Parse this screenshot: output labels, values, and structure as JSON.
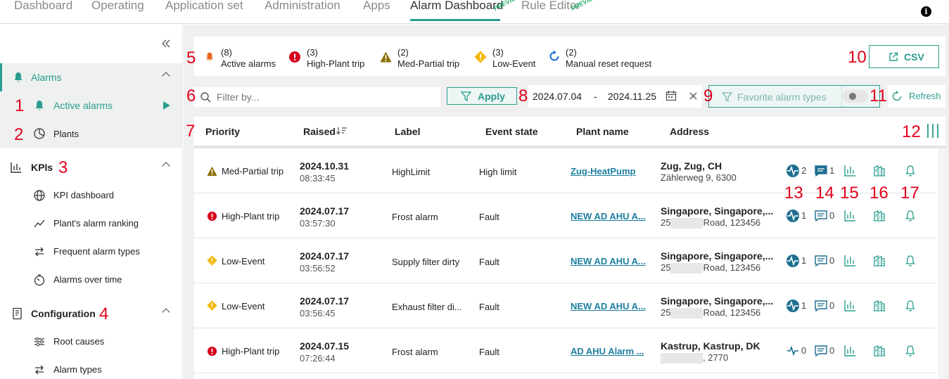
{
  "nav": {
    "tabs": [
      "Dashboard",
      "Operating",
      "Application set",
      "Administration",
      "Apps",
      "Alarm Dashboard",
      "Rule Editor"
    ],
    "active": "Alarm Dashboard",
    "preview_label": "PREVIEW"
  },
  "sidebar": {
    "alarms": {
      "label": "Alarms",
      "items": [
        {
          "label": "Active alarms"
        },
        {
          "label": "Plants"
        }
      ]
    },
    "kpis": {
      "label": "KPIs",
      "items": [
        {
          "label": "KPI dashboard"
        },
        {
          "label": "Plant's alarm ranking"
        },
        {
          "label": "Frequent alarm types"
        },
        {
          "label": "Alarms over time"
        }
      ]
    },
    "configuration": {
      "label": "Configuration",
      "items": [
        {
          "label": "Root causes"
        },
        {
          "label": "Alarm types"
        }
      ]
    }
  },
  "summary": [
    {
      "count": "(8)",
      "label": "Active alarms",
      "icon": "bell-icon"
    },
    {
      "count": "(3)",
      "label": "High-Plant trip",
      "icon": "error-icon"
    },
    {
      "count": "(2)",
      "label": "Med-Partial trip",
      "icon": "warning-icon"
    },
    {
      "count": "(3)",
      "label": "Low-Event",
      "icon": "diamond-warning-icon"
    },
    {
      "count": "(2)",
      "label": "Manual reset request",
      "icon": "reset-icon"
    }
  ],
  "toolbar": {
    "csv_label": "CSV",
    "filter_placeholder": "Filter by...",
    "apply_label": "Apply",
    "date_from": "2024.07.04",
    "date_sep": "-",
    "date_to": "2024.11.25",
    "favorite_label": "Favorite alarm types",
    "refresh_label": "Refresh"
  },
  "table": {
    "headers": {
      "priority": "Priority",
      "raised": "Raised",
      "label": "Label",
      "event_state": "Event state",
      "plant_name": "Plant name",
      "address": "Address"
    },
    "rows": [
      {
        "priority": "Med-Partial trip",
        "date": "2024.10.31",
        "time": "08:33:45",
        "label": "HighLimit",
        "event_state": "High limit",
        "plant": "Zug-HeatPump",
        "addr1": "Zug, Zug, CH",
        "addr2_pre": "Zählerweg 9, 6300",
        "addr2_post": "",
        "activity": "2",
        "comments": "1"
      },
      {
        "priority": "High-Plant trip",
        "date": "2024.07.17",
        "time": "03:57:30",
        "label": "Frost alarm",
        "event_state": "Fault",
        "plant": "NEW AD AHU A...",
        "addr1": "Singapore, Singapore,...",
        "addr2_pre": "25",
        "addr2_post": "Road, 123456",
        "activity": "1",
        "comments": "0"
      },
      {
        "priority": "Low-Event",
        "date": "2024.07.17",
        "time": "03:56:52",
        "label": "Supply filter dirty",
        "event_state": "Fault",
        "plant": "NEW AD AHU A...",
        "addr1": "Singapore, Singapore,...",
        "addr2_pre": "25",
        "addr2_post": "Road, 123456",
        "activity": "1",
        "comments": "0"
      },
      {
        "priority": "Low-Event",
        "date": "2024.07.17",
        "time": "03:56:45",
        "label": "Exhaust filter di...",
        "event_state": "Fault",
        "plant": "NEW AD AHU A...",
        "addr1": "Singapore, Singapore,...",
        "addr2_pre": "25",
        "addr2_post": "Road, 123456",
        "activity": "1",
        "comments": "0"
      },
      {
        "priority": "High-Plant trip",
        "date": "2024.07.15",
        "time": "07:26:44",
        "label": "Frost alarm",
        "event_state": "Fault",
        "plant": "AD AHU Alarm ...",
        "addr1": "Kastrup, Kastrup, DK",
        "addr2_pre": "",
        "addr2_post": ", 2770",
        "activity": "0",
        "comments": "0"
      }
    ]
  },
  "annotations": [
    "1",
    "2",
    "3",
    "4",
    "5",
    "6",
    "7",
    "8",
    "9",
    "10",
    "11",
    "12",
    "13",
    "14",
    "15",
    "16",
    "17"
  ],
  "colors": {
    "accent": "#2a9d8f",
    "link": "#1e7f9f",
    "error": "#d6001c",
    "warning": "#8a6d00",
    "low": "#f2b600",
    "annotation": "#e3001b"
  }
}
